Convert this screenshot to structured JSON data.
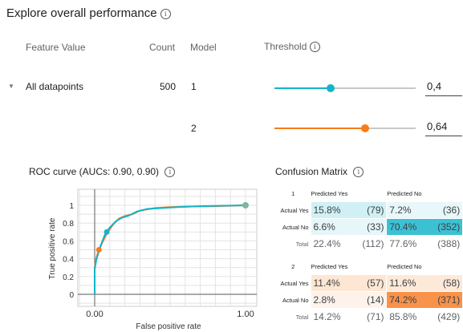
{
  "header": {
    "title": "Explore overall performance"
  },
  "columns": {
    "feature_value": "Feature Value",
    "count": "Count",
    "model": "Model",
    "threshold": "Threshold"
  },
  "row": {
    "label": "All datapoints",
    "count": "500"
  },
  "models": [
    {
      "id": "1",
      "threshold": "0,4",
      "threshold_level": 0.4,
      "color": "#12b5cb"
    },
    {
      "id": "2",
      "threshold": "0,64",
      "threshold_level": 0.64,
      "color": "#fa7b17"
    }
  ],
  "roc": {
    "title": "ROC curve (AUCs: 0.90, 0.90)",
    "xlabel": "False positive rate",
    "ylabel": "True positive rate",
    "yticks": [
      "1",
      "0.8",
      "0.6",
      "0.4",
      "0.2",
      "0"
    ],
    "xticks": [
      "0.00",
      "1.00"
    ]
  },
  "chart_data": {
    "type": "line",
    "title": "ROC curve (AUCs: 0.90, 0.90)",
    "xlabel": "False positive rate",
    "ylabel": "True positive rate",
    "xlim": [
      0,
      1
    ],
    "ylim": [
      0,
      1.1
    ],
    "series": [
      {
        "color": "#fa7b17",
        "x": [
          0,
          0.0,
          0.01,
          0.02,
          0.03,
          0.05,
          0.08,
          0.12,
          0.16,
          0.2,
          0.25,
          0.3,
          0.4,
          0.5,
          0.6,
          0.8,
          1.0
        ],
        "y": [
          0,
          0.3,
          0.4,
          0.46,
          0.5,
          0.58,
          0.68,
          0.78,
          0.85,
          0.88,
          0.9,
          0.94,
          0.97,
          0.98,
          0.985,
          0.99,
          1.0
        ],
        "marker": {
          "x": 0.028,
          "y": 0.5
        }
      },
      {
        "color": "#12b5cb",
        "x": [
          0,
          0.0,
          0.01,
          0.02,
          0.04,
          0.07,
          0.1,
          0.14,
          0.18,
          0.22,
          0.28,
          0.35,
          0.45,
          0.55,
          0.7,
          0.85,
          1.0
        ],
        "y": [
          0,
          0.28,
          0.38,
          0.44,
          0.55,
          0.68,
          0.75,
          0.82,
          0.86,
          0.88,
          0.93,
          0.96,
          0.97,
          0.98,
          0.99,
          0.995,
          1.0
        ],
        "marker": {
          "x": 0.08,
          "y": 0.7
        }
      }
    ],
    "endpoint": {
      "x": 1.0,
      "y": 1.0
    }
  },
  "confusion": {
    "title": "Confusion Matrix",
    "pred_yes": "Predicted Yes",
    "pred_no": "Predicted No",
    "actual_yes": "Actual Yes",
    "actual_no": "Actual No",
    "total": "Total",
    "matrices": [
      {
        "id": "1",
        "ay_py_pct": "15.8%",
        "ay_py_cnt": "(79)",
        "ay_pn_pct": "7.2%",
        "ay_pn_cnt": "(36)",
        "an_py_pct": "6.6%",
        "an_py_cnt": "(33)",
        "an_pn_pct": "70.4%",
        "an_pn_cnt": "(352)",
        "t_py_pct": "22.4%",
        "t_py_cnt": "(112)",
        "t_pn_pct": "77.6%",
        "t_pn_cnt": "(388)"
      },
      {
        "id": "2",
        "ay_py_pct": "11.4%",
        "ay_py_cnt": "(57)",
        "ay_pn_pct": "11.6%",
        "ay_pn_cnt": "(58)",
        "an_py_pct": "2.8%",
        "an_py_cnt": "(14)",
        "an_pn_pct": "74.2%",
        "an_pn_cnt": "(371)",
        "t_py_pct": "14.2%",
        "t_py_cnt": "(71)",
        "t_pn_pct": "85.8%",
        "t_pn_cnt": "(429)"
      }
    ]
  }
}
